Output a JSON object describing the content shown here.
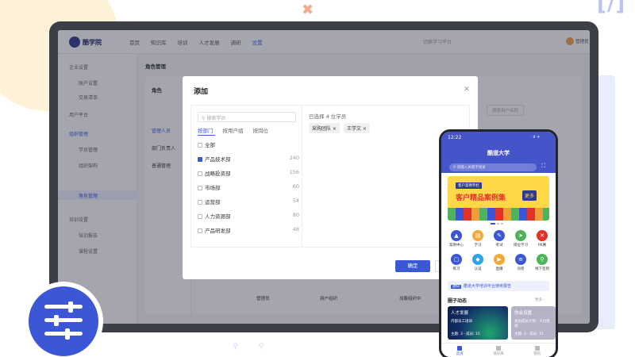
{
  "app": {
    "logo_text": "酷学院",
    "nav": [
      "首页",
      "知识库",
      "培训",
      "人才发展",
      "调研",
      "设置"
    ],
    "nav_active": "设置",
    "toolbar_right": [
      "切换学习平台",
      "·",
      "·",
      "·",
      "·"
    ],
    "user": "管理员"
  },
  "sidebar": {
    "items": [
      "企业设置",
      "账户设置",
      "交易清单",
      "用户平台",
      "组织管理",
      "学员管理",
      "角色管理",
      "组织架构",
      "培训设置",
      "培训报告",
      "课程设置"
    ],
    "active": "角色管理"
  },
  "page": {
    "breadcrumb": "角色管理",
    "col_header": "角色",
    "roles": [
      "管理人员",
      "部门负责人",
      "普通管理"
    ],
    "search_right": "搜索用户名称",
    "table_headers": [
      "管理员",
      "用户组织",
      "加载组织中"
    ]
  },
  "dialog": {
    "title": "添加",
    "search_placeholder": "搜索学员",
    "tabs": [
      "按部门",
      "按用户组",
      "按岗位"
    ],
    "active_tab": "按部门",
    "departments": [
      {
        "name": "全部",
        "count": "",
        "checked": false
      },
      {
        "name": "产品技术部",
        "count": "240",
        "checked": true
      },
      {
        "name": "战略投资部",
        "count": "156",
        "checked": false
      },
      {
        "name": "市场部",
        "count": "60",
        "checked": false
      },
      {
        "name": "运营部",
        "count": "54",
        "checked": false
      },
      {
        "name": "人力资源部",
        "count": "80",
        "checked": false
      },
      {
        "name": "产品研发部",
        "count": "48",
        "checked": false
      }
    ],
    "selected_title": "已选择 4 位学员",
    "selected_chips": [
      "采购团队",
      "王学文"
    ],
    "ok_label": "确定"
  },
  "phone": {
    "time": "12:22",
    "status": "·ıl ᯤ",
    "title": "酷道大学",
    "search_placeholder": "请输入关键字搜索",
    "banner": {
      "tag": "客户案例专栏",
      "title": "客户精品案例集",
      "more": "更多"
    },
    "grid": [
      {
        "label": "案例中心",
        "color": "#3b57d6",
        "glyph": "▲"
      },
      {
        "label": "学习",
        "color": "#f2a93b",
        "glyph": "▤"
      },
      {
        "label": "考试",
        "color": "#3b57d6",
        "glyph": "✎"
      },
      {
        "label": "岗位学习",
        "color": "#4fb35a",
        "glyph": "➤"
      },
      {
        "label": "PK赛",
        "color": "#e2332a",
        "glyph": "✕"
      },
      {
        "label": "练习",
        "color": "#3b57d6",
        "glyph": "▢"
      },
      {
        "label": "认证",
        "color": "#2fa3e8",
        "glyph": "◆"
      },
      {
        "label": "直播",
        "color": "#f2a93b",
        "glyph": "▶"
      },
      {
        "label": "问卷",
        "color": "#3b57d6",
        "glyph": "≡"
      },
      {
        "label": "线下签到",
        "color": "#4fb35a",
        "glyph": "⚲"
      }
    ],
    "notice_tag": "通知",
    "notice": "酷道大学培训平台使用报告",
    "section_title": "圈子动态",
    "section_more": "更多 ›",
    "cards": [
      {
        "title": "人才发展",
        "sub": "内部员工培训",
        "meta": "主题: 3 · 成员: 15"
      },
      {
        "title": "你会设置",
        "sub": "会员成长计划 · 人力资源",
        "meta": "主题: 3 · 成员: 15"
      }
    ],
    "tabbar": [
      "首页",
      "培训库",
      "我的"
    ]
  },
  "decor": {
    "bracket": "[/]",
    "x_mark": "✖",
    "faint_icons": [
      "⚲",
      "⚲"
    ]
  }
}
